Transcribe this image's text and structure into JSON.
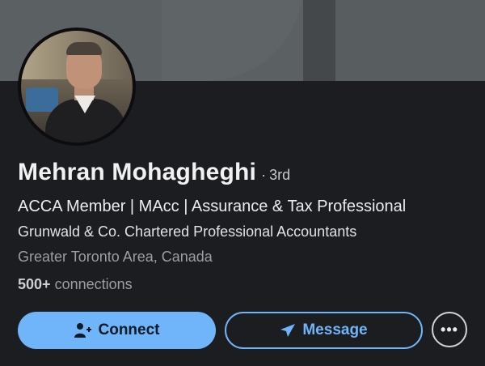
{
  "profile": {
    "name": "Mehran Mohagheghi",
    "degree_separator": "·",
    "degree": "3rd",
    "headline": "ACCA Member | MAcc | Assurance & Tax Professional",
    "company": "Grunwald & Co. Chartered Professional Accountants",
    "location": "Greater Toronto Area, Canada",
    "connections_count": "500+",
    "connections_label": "connections"
  },
  "actions": {
    "connect_label": "Connect",
    "message_label": "Message",
    "more_label": "•••"
  },
  "icons": {
    "connect": "add-person-icon",
    "message": "send-icon",
    "more": "more-options-icon"
  },
  "colors": {
    "background": "#1c1d21",
    "accent": "#70b5f9",
    "secondary_text": "#9c9ea2"
  }
}
